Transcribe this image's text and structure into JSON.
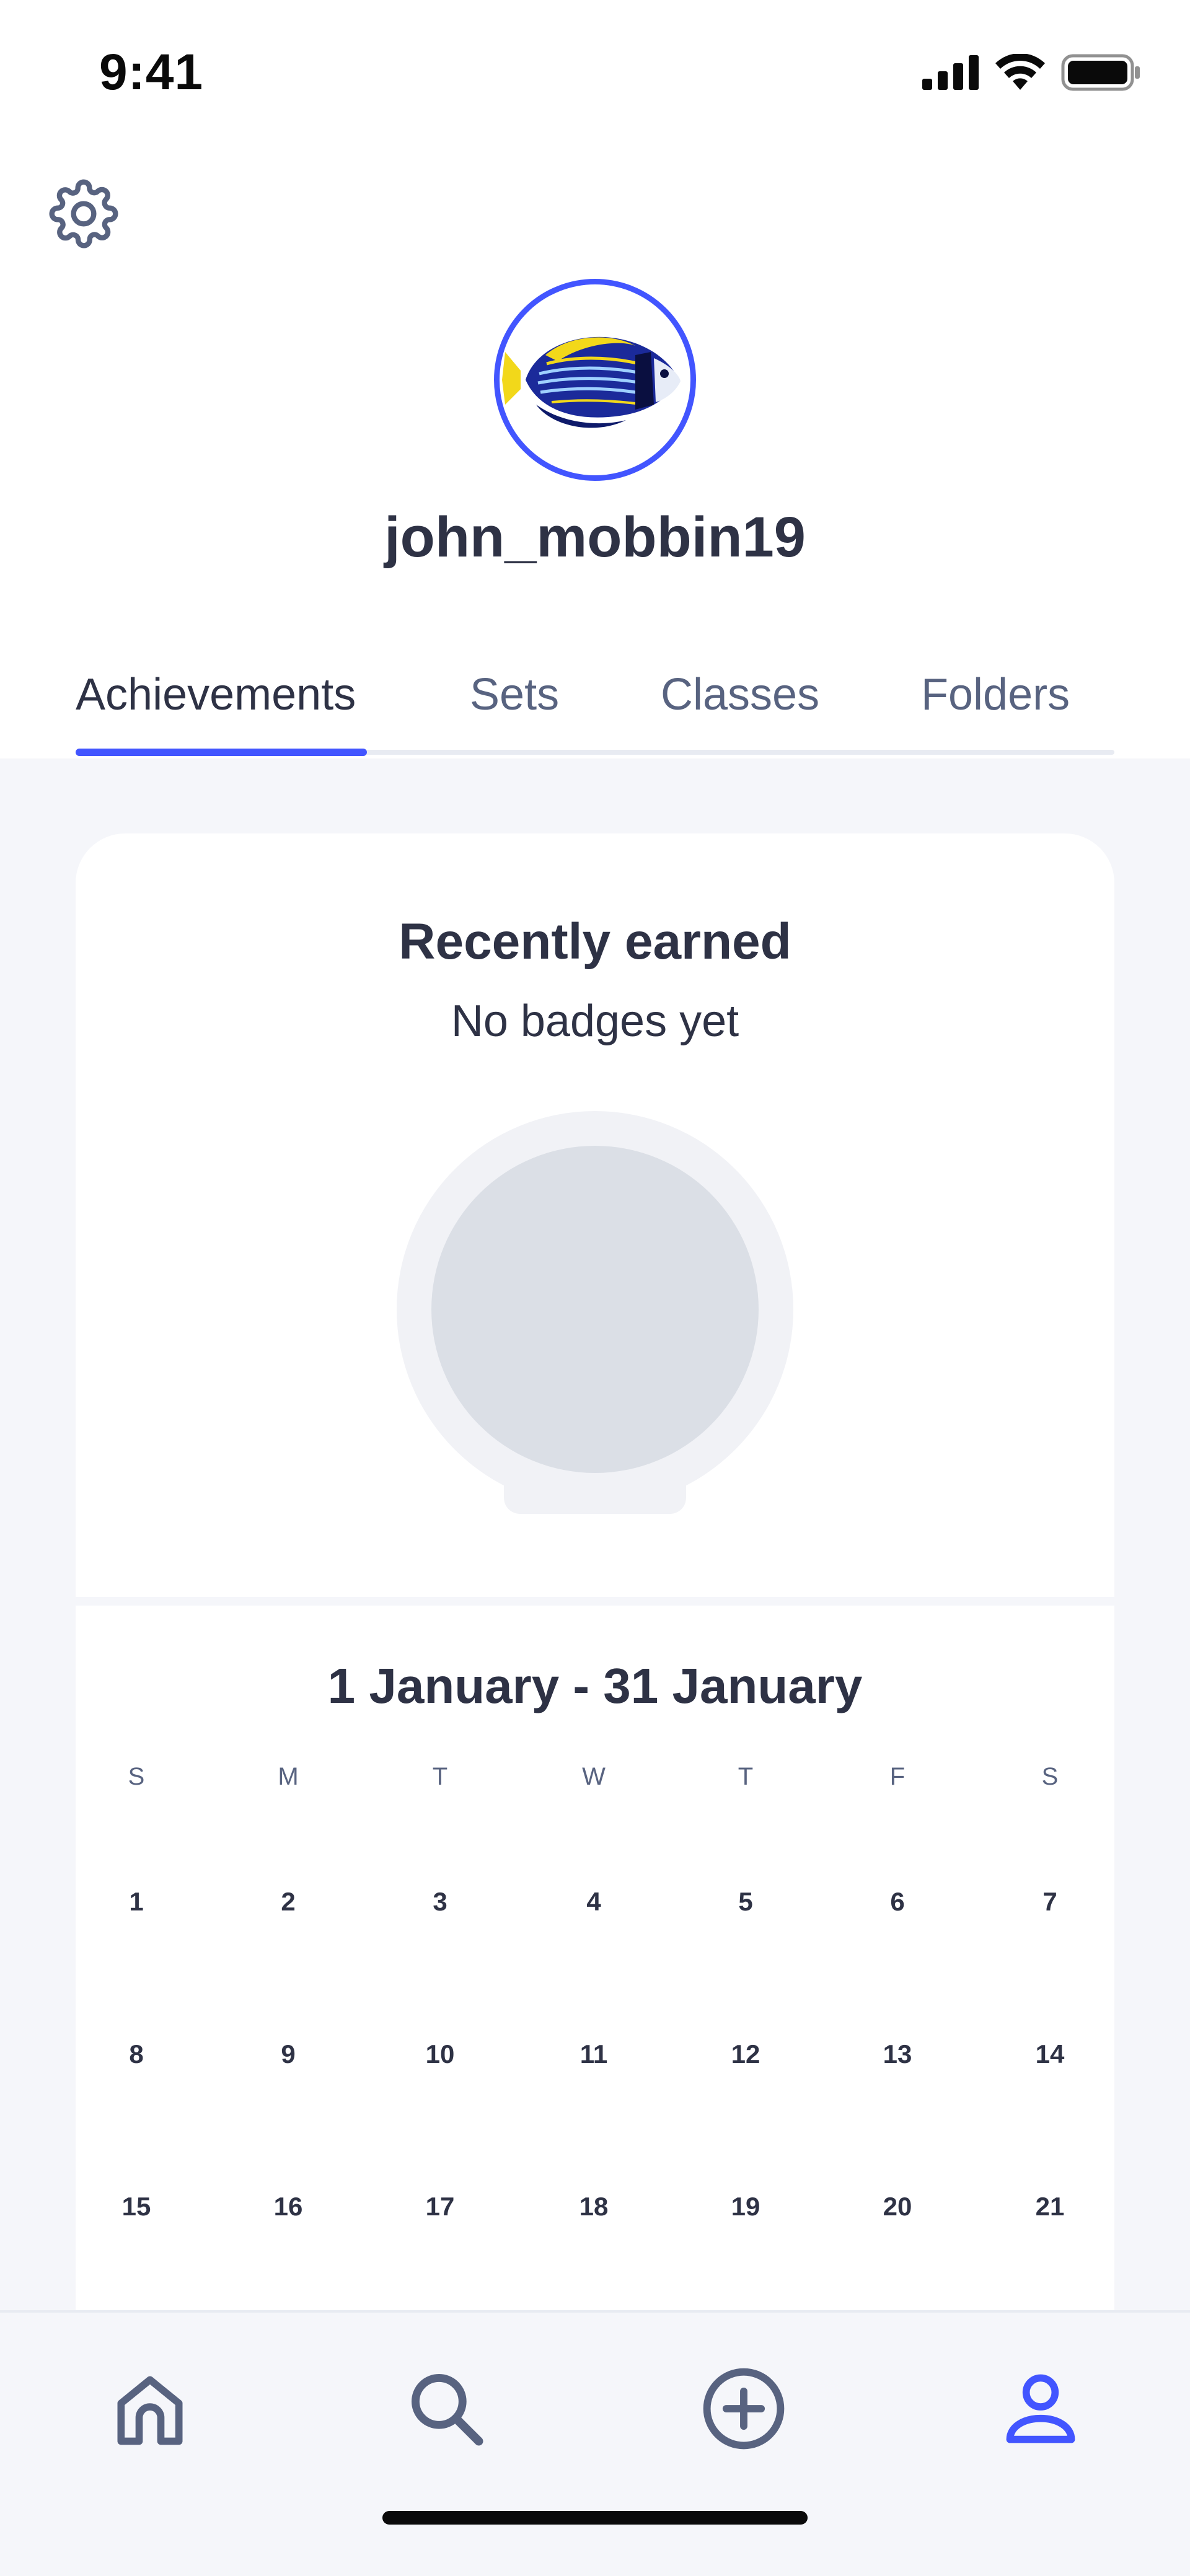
{
  "status_bar": {
    "time": "9:41"
  },
  "profile": {
    "username": "john_mobbin19"
  },
  "tabs": [
    {
      "label": "Achievements"
    },
    {
      "label": "Sets"
    },
    {
      "label": "Classes"
    },
    {
      "label": "Folders"
    }
  ],
  "recently_earned": {
    "title": "Recently earned",
    "subtitle": "No badges yet"
  },
  "calendar": {
    "range_title": "1 January - 31 January",
    "weekdays": [
      "S",
      "M",
      "T",
      "W",
      "T",
      "F",
      "S"
    ],
    "weeks": [
      [
        "1",
        "2",
        "3",
        "4",
        "5",
        "6",
        "7"
      ],
      [
        "8",
        "9",
        "10",
        "11",
        "12",
        "13",
        "14"
      ],
      [
        "15",
        "16",
        "17",
        "18",
        "19",
        "20",
        "21"
      ]
    ]
  },
  "bottom_nav": {
    "items": [
      {
        "icon": "home-icon"
      },
      {
        "icon": "search-icon"
      },
      {
        "icon": "create-icon"
      },
      {
        "icon": "profile-icon",
        "active": true
      }
    ]
  },
  "colors": {
    "accent": "#4255ff",
    "text_primary": "#2e3245",
    "text_secondary": "#586380",
    "background": "#f5f6fa",
    "badge_placeholder": "#dbdfe6"
  }
}
